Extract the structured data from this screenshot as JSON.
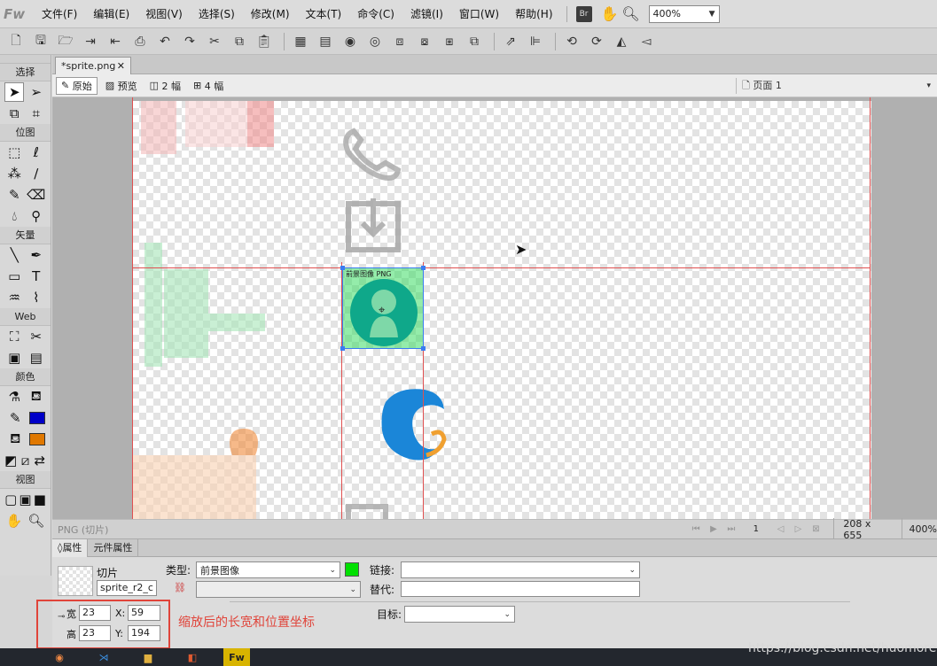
{
  "app": {
    "logo": "Fw"
  },
  "menu": [
    "文件(F)",
    "编辑(E)",
    "视图(V)",
    "选择(S)",
    "修改(M)",
    "文本(T)",
    "命令(C)",
    "滤镜(I)",
    "窗口(W)",
    "帮助(H)"
  ],
  "topbar": {
    "bridge_badge": "Br",
    "zoom_value": "400%"
  },
  "tools": {
    "sections": [
      "选择",
      "位图",
      "矢量",
      "Web",
      "颜色",
      "视图"
    ],
    "stroke_color": "#0000c8",
    "fill_color": "#e07800"
  },
  "document": {
    "tab_label": "*sprite.png"
  },
  "view_modes": [
    "原始",
    "预览",
    "2 幅",
    "4 幅"
  ],
  "page_select": "页面 1",
  "canvas": {
    "slice_label": "前景图像 PNG"
  },
  "status": {
    "text": "PNG (切片)",
    "frame": "1",
    "size": "208 x 655",
    "zoom": "400%"
  },
  "properties": {
    "tabs": [
      "属性",
      "元件属性"
    ],
    "object_kind": "切片",
    "object_name": "sprite_r2_c",
    "type_label": "类型:",
    "type_value": "前景图像",
    "slice_color": "#00e000",
    "link_label": "链接:",
    "link_value": "",
    "alt_label": "替代:",
    "alt_value": "",
    "target_label": "目标:",
    "target_value": "",
    "width_label": "宽",
    "height_label": "高",
    "width": "23",
    "height": "23",
    "x_label": "X:",
    "y_label": "Y:",
    "x": "59",
    "y": "194"
  },
  "annotation": "缩放后的长宽和位置坐标",
  "watermark": "https://blog.csdn.net/huomore"
}
